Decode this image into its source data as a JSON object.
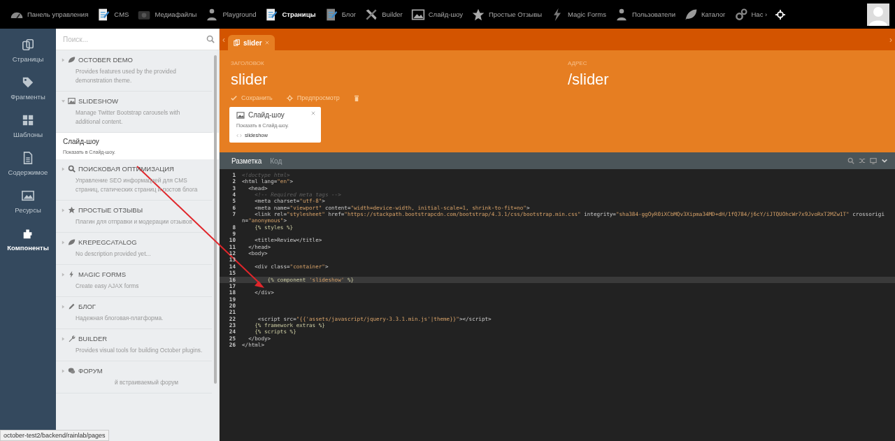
{
  "top_nav": {
    "items": [
      {
        "label": "Панель управления",
        "selected": false
      },
      {
        "label": "CMS",
        "selected": false
      },
      {
        "label": "Медиафайлы",
        "selected": false
      },
      {
        "label": "Playground",
        "selected": false
      },
      {
        "label": "Страницы",
        "selected": true
      },
      {
        "label": "Блог",
        "selected": false
      },
      {
        "label": "Builder",
        "selected": false
      },
      {
        "label": "Слайд-шоу",
        "selected": false
      },
      {
        "label": "Простые Отзывы",
        "selected": false
      },
      {
        "label": "Magic Forms",
        "selected": false
      },
      {
        "label": "Пользователи",
        "selected": false
      },
      {
        "label": "Каталог",
        "selected": false
      },
      {
        "label": "Нас ›",
        "selected": false
      }
    ]
  },
  "side_nav": {
    "items": [
      {
        "label": "Страницы",
        "selected": false
      },
      {
        "label": "Фрагменты",
        "selected": false
      },
      {
        "label": "Шаблоны",
        "selected": false
      },
      {
        "label": "Содержимое",
        "selected": false
      },
      {
        "label": "Ресурсы",
        "selected": false
      },
      {
        "label": "Компоненты",
        "selected": true
      }
    ]
  },
  "components_panel": {
    "search": {
      "placeholder": "Поиск..."
    },
    "plugins": [
      {
        "title": "OCTOBER DEMO",
        "description": "Provides features used by the provided demonstration theme.",
        "expanded": false
      },
      {
        "title": "SLIDESHOW",
        "description": "Manage Twitter Bootstrap carousels with additional content.",
        "expanded": true,
        "children": [
          {
            "title": "Слайд-шоу",
            "description": "Показать в Слайд-шоу."
          }
        ]
      },
      {
        "title": "ПОИСКОВАЯ ОПТИМИЗАЦИЯ",
        "description": "Управление SEO информацией для CMS страниц, статических страниц и постов блога",
        "expanded": false
      },
      {
        "title": "ПРОСТЫЕ ОТЗЫВЫ",
        "description": "Плагин для отправки и модерации отзывов",
        "expanded": false
      },
      {
        "title": "KREPEGCATALOG",
        "description": "No description provided yet...",
        "expanded": false
      },
      {
        "title": "MAGIC FORMS",
        "description": "Create easy AJAX forms",
        "expanded": false
      },
      {
        "title": "БЛОГ",
        "description": "Надежная блоговая-платформа.",
        "expanded": false
      },
      {
        "title": "BUILDER",
        "description": "Provides visual tools for building October plugins.",
        "expanded": false
      },
      {
        "title": "ФОРУМ",
        "description": "й встраиваемый форум",
        "expanded": false,
        "occluded": true
      }
    ]
  },
  "editor": {
    "tab_scroll": {
      "left": "‹",
      "right": "›"
    },
    "tabs": [
      {
        "label": "slider",
        "selected": true
      }
    ],
    "fields": [
      {
        "label": "ЗАГОЛОВОК",
        "value": "slider"
      },
      {
        "label": "АДРЕС",
        "value": "/slider"
      }
    ],
    "toolbar": {
      "save": "Сохранить",
      "preview": "Предпросмотр"
    },
    "component_card": {
      "title": "Слайд-шоу",
      "description": "Показать в Слайд-шоу.",
      "alias": "slideshow"
    },
    "mode_tabs": [
      {
        "label": "Разметка",
        "selected": true
      },
      {
        "label": "Код",
        "selected": false
      }
    ],
    "code_lines": [
      {
        "n": "1",
        "text": "<!doctype html>",
        "current": false
      },
      {
        "n": "2",
        "text": "<html lang=\"en\">",
        "current": false
      },
      {
        "n": "3",
        "text": "  <head>",
        "current": false
      },
      {
        "n": "4",
        "text": "    <!-- Required meta tags -->",
        "current": false
      },
      {
        "n": "5",
        "text": "    <meta charset=\"utf-8\">",
        "current": false
      },
      {
        "n": "6",
        "text": "    <meta name=\"viewport\" content=\"width=device-width, initial-scale=1, shrink-to-fit=no\">",
        "current": false
      },
      {
        "n": "7",
        "text": "    <link rel=\"stylesheet\" href=\"https://stackpath.bootstrapcdn.com/bootstrap/4.3.1/css/bootstrap.min.css\" integrity=\"sha384-ggOyR0iXCbMQv3Xipma34MD+dH/1fQ784/j6cY/iJTQUOhcWr7x9JvoRxT2MZw1T\" crossorigin=\"anonymous\">",
        "current": false
      },
      {
        "n": "8",
        "text": "    {% styles %}",
        "current": false
      },
      {
        "n": "9",
        "current": false
      },
      {
        "n": "10",
        "text": "    <title>Review</title>",
        "current": false
      },
      {
        "n": "11",
        "text": "  </head>",
        "current": false
      },
      {
        "n": "12",
        "text": "  <body>",
        "current": false
      },
      {
        "n": "13",
        "current": false
      },
      {
        "n": "14",
        "text": "    <div class=\"container\">",
        "current": false
      },
      {
        "n": "15",
        "current": false
      },
      {
        "n": "16",
        "text": "        {% component 'slideshow' %}",
        "current": true
      },
      {
        "n": "17",
        "current": false
      },
      {
        "n": "18",
        "text": "    </div>",
        "current": false
      },
      {
        "n": "19",
        "current": false
      },
      {
        "n": "20",
        "current": false
      },
      {
        "n": "21",
        "current": false
      },
      {
        "n": "22",
        "text": "     <script src=\"{{'assets/javascript/jquery-3.3.1.min.js'|theme}}\"></script>",
        "current": false
      },
      {
        "n": "23",
        "text": "    {% framework extras %}",
        "current": false
      },
      {
        "n": "24",
        "text": "    {% scripts %}",
        "current": false
      },
      {
        "n": "25",
        "text": "  </body>",
        "current": false
      },
      {
        "n": "26",
        "text": "</html>",
        "current": false
      }
    ]
  },
  "status_tooltip": "october-test2/backend/rainlab/pages"
}
